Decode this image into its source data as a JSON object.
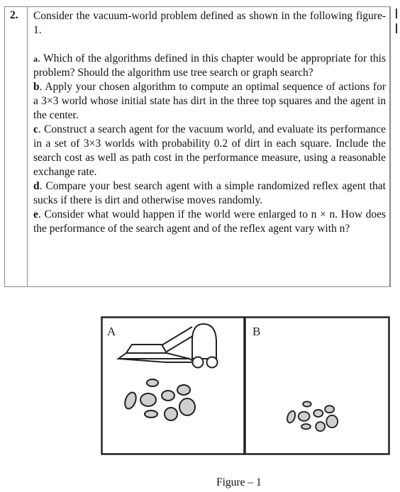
{
  "question": {
    "number": "2.",
    "intro": "Consider the vacuum-world problem defined as shown in the following figure-1.",
    "parts": [
      {
        "letter": "a",
        "text": ". Which of the algorithms defined in this chapter would be appropriate for this problem? Should the algorithm use tree search or graph search?"
      },
      {
        "letter": "b",
        "text": ". Apply your chosen algorithm to compute an optimal sequence of actions for a 3×3 world whose initial state has dirt in the three top squares and the agent in the center."
      },
      {
        "letter": "c",
        "text": ". Construct a search agent for the vacuum world, and evaluate its performance in a set of 3×3 worlds with probability 0.2 of dirt in each square. Include the search cost as well as path cost in the performance measure, using a reasonable exchange rate."
      },
      {
        "letter": "d",
        "text": ". Compare your best search agent with a simple randomized reflex agent that sucks if there is dirt and otherwise moves randomly."
      },
      {
        "letter": "e",
        "text": ". Consider what would happen if the world were enlarged to n × n. How does the performance of the search agent and of the reflex agent vary with n?"
      }
    ]
  },
  "figure": {
    "cells": [
      {
        "label": "A",
        "has_vacuum": true,
        "has_dirt": true
      },
      {
        "label": "B",
        "has_vacuum": false,
        "has_dirt": true
      }
    ],
    "caption": "Figure – 1",
    "dirt_color": "#cfcfcf",
    "stroke_color": "#222222"
  }
}
